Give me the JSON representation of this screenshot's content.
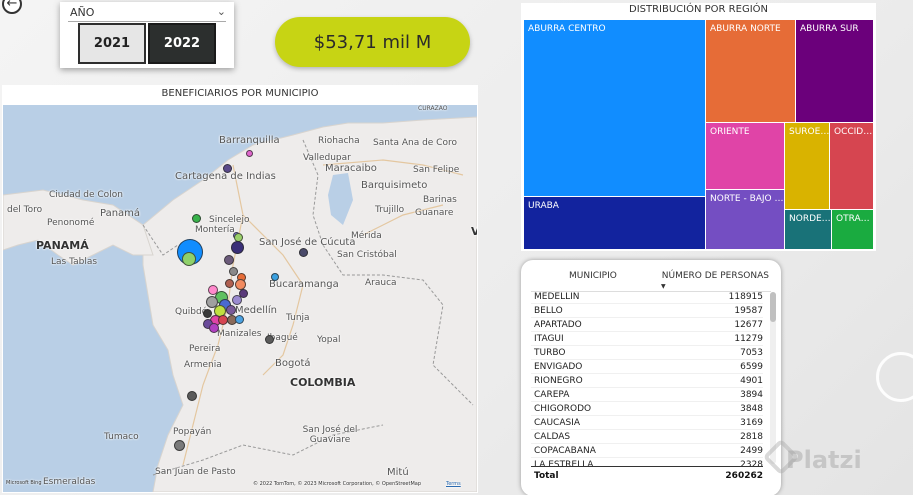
{
  "nav": {
    "back_glyph": "←"
  },
  "year_slicer": {
    "title": "AÑO",
    "chevron": "⌄",
    "options": [
      {
        "label": "2021",
        "selected": false
      },
      {
        "label": "2022",
        "selected": true
      }
    ]
  },
  "kpi": {
    "value": "$53,71 mil M",
    "color": "#c7d414"
  },
  "map": {
    "title": "BENEFICIARIOS POR MUNICIPIO",
    "labels": {
      "curazao": "CURAZAO",
      "barranquilla": "Barranquilla",
      "riohacha": "Riohacha",
      "santa_ana_de_coro": "Santa Ana de Coro",
      "valledupar": "Valledupar",
      "cartagena": "Cartagena de Indias",
      "maracaibo": "Maracaibo",
      "san_felipe": "San Felipe",
      "barquisimeto": "Barquisimeto",
      "ciudad_de_colon": "Ciudad de Colon",
      "del_toro": "del Toro",
      "penonome": "Penonomé",
      "panama_city": "Panamá",
      "sincelejo": "Sincelejo",
      "trujillo": "Trujillo",
      "guanare": "Guanare",
      "barinas": "Barinas",
      "panama_country": "PANAMÁ",
      "monteria": "Montería",
      "san_jose_de_cucuta": "San José de Cúcuta",
      "merida": "Mérida",
      "las_tablas": "Las Tablas",
      "san_cristobal": "San Cristóbal",
      "bucaramanga": "Bucaramanga",
      "arauca": "Arauca",
      "quibdo": "Quibdó",
      "medellin": "Medellín",
      "tunja": "Tunja",
      "manizales": "Manizales",
      "yopal": "Yopal",
      "pereira": "Pereira",
      "bogota": "Bogotá",
      "ibague": "Ibagué",
      "armenia": "Armenia",
      "colombia": "COLOMBIA",
      "tumaco": "Tumaco",
      "popayan": "Popayán",
      "san_jose_del_guaviare": "San José del Guaviare",
      "san_juan_de_pasto": "San Juan de Pasto",
      "esmeraldas": "Esmeraldas",
      "mitu": "Mitú",
      "v": "V"
    },
    "attribution": "© 2022 TomTom, © 2023 Microsoft Corporation, © OpenStreetMap",
    "terms": "Terms",
    "bing": "Microsoft Bing"
  },
  "treemap": {
    "title": "DISTRIBUCIÓN POR REGIÓN",
    "tiles": [
      {
        "label": "ABURRA CENTRO",
        "color": "#118dff"
      },
      {
        "label": "URABA",
        "color": "#12239e"
      },
      {
        "label": "ABURRA NORTE",
        "color": "#e66c37"
      },
      {
        "label": "ABURRA SUR",
        "color": "#6b007b"
      },
      {
        "label": "ORIENTE",
        "color": "#e044a7"
      },
      {
        "label": "SUROE…",
        "color": "#d9b300"
      },
      {
        "label": "OCCID…",
        "color": "#d64550"
      },
      {
        "label": "NORTE - BAJO …",
        "color": "#744ec2"
      },
      {
        "label": "NORDE…",
        "color": "#197278"
      },
      {
        "label": "OTRA…",
        "color": "#1aab40"
      }
    ]
  },
  "table": {
    "columns": [
      "MUNICIPIO",
      "NÚMERO DE PERSONAS"
    ],
    "sort_glyph": "▼",
    "rows": [
      {
        "name": "MEDELLIN",
        "value": "118915"
      },
      {
        "name": "BELLO",
        "value": "19587"
      },
      {
        "name": "APARTADO",
        "value": "12677"
      },
      {
        "name": "ITAGUI",
        "value": "11279"
      },
      {
        "name": "TURBO",
        "value": "7053"
      },
      {
        "name": "ENVIGADO",
        "value": "6599"
      },
      {
        "name": "RIONEGRO",
        "value": "4901"
      },
      {
        "name": "CAREPA",
        "value": "3894"
      },
      {
        "name": "CHIGORODO",
        "value": "3848"
      },
      {
        "name": "CAUCASIA",
        "value": "3169"
      },
      {
        "name": "CALDAS",
        "value": "2818"
      },
      {
        "name": "COPACABANA",
        "value": "2499"
      },
      {
        "name": "LA ESTRELLA",
        "value": "2328"
      }
    ],
    "total_label": "Total",
    "total_value": "260262"
  },
  "watermark": {
    "text": "Platzi"
  }
}
